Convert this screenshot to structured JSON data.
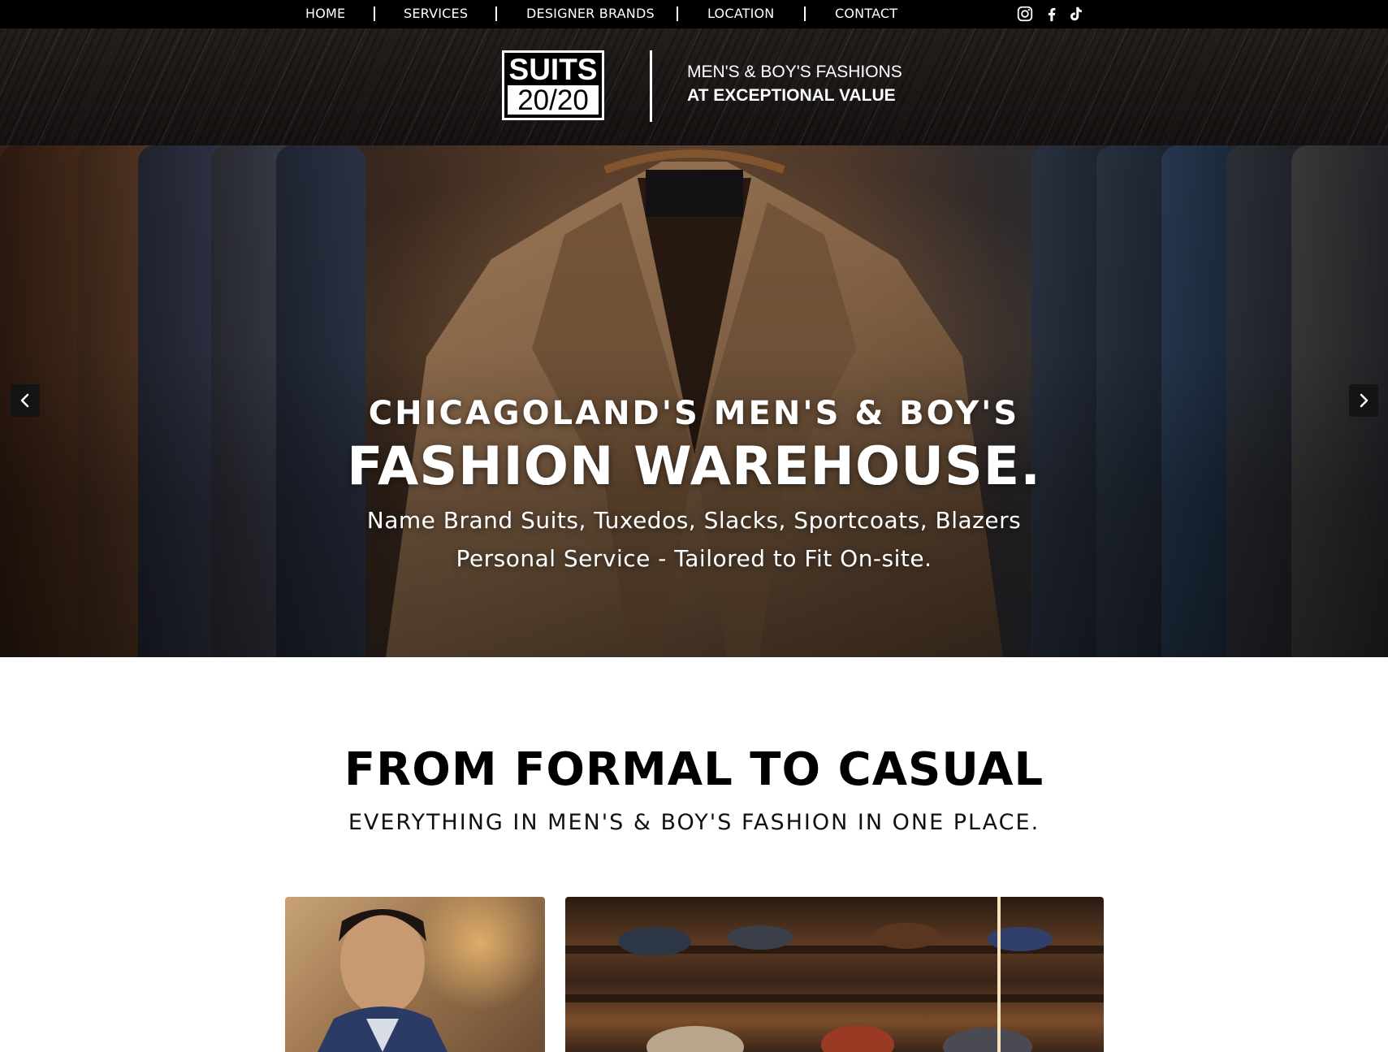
{
  "nav": {
    "items": [
      "HOME",
      "SERVICES",
      "DESIGNER BRANDS",
      "LOCATION",
      "CONTACT"
    ],
    "social_icons": [
      "instagram-icon",
      "facebook-icon",
      "tiktok-icon"
    ]
  },
  "header": {
    "logo_top": "SUITS",
    "logo_bottom": "20/20",
    "tagline_1": "MEN'S & BOY'S FASHIONS",
    "tagline_2": "AT EXCEPTIONAL VALUE"
  },
  "hero": {
    "line1": "CHICAGOLAND'S MEN'S & BOY'S",
    "line2": "FASHION WAREHOUSE.",
    "line3": "Name Brand Suits, Tuxedos, Slacks, Sportcoats, Blazers",
    "line4": "Personal Service - Tailored to Fit On-site.",
    "prev_icon": "chevron-left-icon",
    "next_icon": "chevron-right-icon"
  },
  "section": {
    "title": "FROM FORMAL TO CASUAL",
    "subtitle": "EVERYTHING IN MEN'S & BOY'S FASHION IN ONE PLACE."
  },
  "colors": {
    "nav_bg": "#000000",
    "header_bg": "#1b1716",
    "text_light": "#ffffff",
    "text_dark": "#000000"
  }
}
